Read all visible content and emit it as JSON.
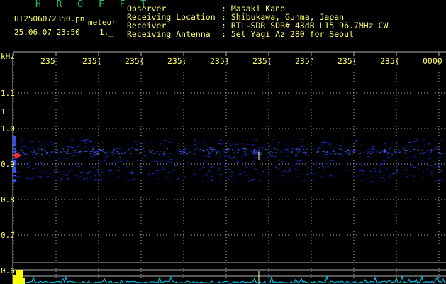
{
  "header": {
    "brand": "H R O F F T",
    "filename": "UT2506072350.pn",
    "tag": "meteor",
    "datetime": "25.06.07 23:50",
    "count": "1._"
  },
  "station": [
    {
      "label": "Observer",
      "value": ": Masaki Kano"
    },
    {
      "label": "Receiving Location",
      "value": ": Shibukawa, Gunma, Japan"
    },
    {
      "label": "Receiver",
      "value": ": RTL-SDR SDR# 43dB L15 96.7MHz CW"
    },
    {
      "label": "Receiving Antenna",
      "value": ": 5el Yagi Az 280 for Seoul"
    }
  ],
  "spectrogram": {
    "y_unit": "kHz",
    "time_ticks": [
      "235",
      "235(",
      "235(",
      "235:",
      "235!",
      "235(",
      "235'",
      "235(",
      "235(",
      "0000"
    ],
    "freq_ticks": [
      "1.1",
      "1",
      "1.0",
      "0.9",
      "0.8",
      "0.7",
      "0.6"
    ],
    "colors": {
      "label": "#ffff66",
      "grid": "#b0b0b0",
      "brand": "#22c55e",
      "trace": "#2233ff",
      "baseline": "#00d5ff",
      "highlight": "#ff3333"
    }
  }
}
